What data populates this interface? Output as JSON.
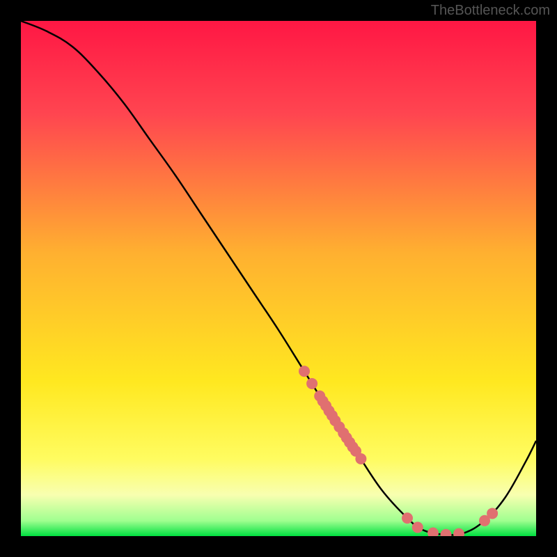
{
  "watermark": "TheBottleneck.com",
  "chart_data": {
    "type": "line",
    "title": "",
    "xlabel": "",
    "ylabel": "",
    "xlim": [
      0,
      100
    ],
    "ylim": [
      0,
      100
    ],
    "background_gradient": {
      "stops": [
        {
          "offset": 0,
          "color": "#ff1744"
        },
        {
          "offset": 18,
          "color": "#ff4550"
        },
        {
          "offset": 45,
          "color": "#ffb030"
        },
        {
          "offset": 70,
          "color": "#ffe820"
        },
        {
          "offset": 85,
          "color": "#fffc60"
        },
        {
          "offset": 92,
          "color": "#f8ffb0"
        },
        {
          "offset": 97,
          "color": "#a0ff90"
        },
        {
          "offset": 100,
          "color": "#00e040"
        }
      ]
    },
    "series": [
      {
        "name": "curve",
        "x": [
          0,
          5,
          10,
          15,
          20,
          25,
          30,
          35,
          40,
          45,
          50,
          55,
          60,
          65,
          70,
          75,
          78,
          82,
          86,
          90,
          94,
          98,
          100
        ],
        "y": [
          100,
          98,
          95,
          90,
          84,
          77,
          70,
          62.5,
          55,
          47.5,
          40,
          32,
          24,
          16.5,
          9,
          3.5,
          1.2,
          0.3,
          0.6,
          3,
          7.5,
          14.5,
          18.5
        ]
      }
    ],
    "markers": {
      "name": "highlight-points",
      "color": "#e07070",
      "radius": 8,
      "points": [
        {
          "x": 55,
          "y": 32
        },
        {
          "x": 56.5,
          "y": 29.6
        },
        {
          "x": 58,
          "y": 27.2
        },
        {
          "x": 58.6,
          "y": 26.2
        },
        {
          "x": 59.2,
          "y": 25.3
        },
        {
          "x": 59.8,
          "y": 24.3
        },
        {
          "x": 60.4,
          "y": 23.4
        },
        {
          "x": 61,
          "y": 22.4
        },
        {
          "x": 61.8,
          "y": 21.2
        },
        {
          "x": 62.6,
          "y": 20
        },
        {
          "x": 63.2,
          "y": 19.1
        },
        {
          "x": 63.8,
          "y": 18.2
        },
        {
          "x": 64.4,
          "y": 17.3
        },
        {
          "x": 65,
          "y": 16.5
        },
        {
          "x": 66,
          "y": 15
        },
        {
          "x": 75,
          "y": 3.5
        },
        {
          "x": 77,
          "y": 1.7
        },
        {
          "x": 80,
          "y": 0.6
        },
        {
          "x": 82.5,
          "y": 0.3
        },
        {
          "x": 85,
          "y": 0.45
        },
        {
          "x": 90,
          "y": 3
        },
        {
          "x": 91.5,
          "y": 4.4
        }
      ]
    }
  }
}
